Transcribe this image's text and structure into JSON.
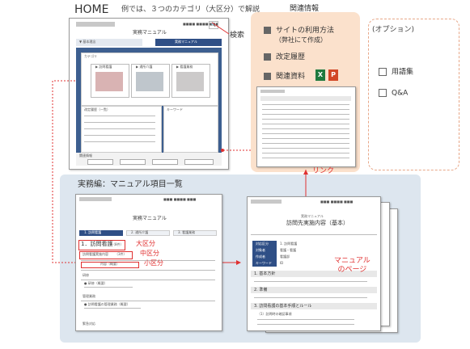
{
  "home": {
    "label": "HOME",
    "caption": "例では、３つのカテゴリ（大区分）で解説",
    "search_label": "検索"
  },
  "home_shot": {
    "site_title": "実務マニュアル",
    "tab_left": "▼ 基本理念",
    "tab_right": "実務マニュアル",
    "category_header": "カテゴリ",
    "cat1": "▶ 訪問看護",
    "cat2": "▶ 通所介護",
    "cat3": "▶ 看護業務",
    "update_header": "改定履歴（一覧）",
    "keyword_header": "キーワード",
    "links_header": "関連情報"
  },
  "related": {
    "title": "関連情報",
    "item1": "サイトの利用方法",
    "item1_sub": "（弊社にて作成）",
    "item2": "改定履歴",
    "item3": "関連資料",
    "excel_letter": "X",
    "ppt_letter": "P"
  },
  "option": {
    "title": "(オプション)",
    "item1": "用語集",
    "item2": "Q&A"
  },
  "link_label": "リンク",
  "list_section": {
    "title": "実務編：マニュアル項目一覧",
    "site_title": "実務マニュアル",
    "tab_active": "1. 訪問看護",
    "tab2": "2. 通所介護",
    "tab3": "3. 看護業務",
    "major": "1．訪問看護",
    "major_count": "（8件）",
    "mid": "訪問看護実施内容",
    "mid_count": "（3件）",
    "minor": "内容（概要）",
    "label_major": "大区分",
    "label_mid": "中区分",
    "label_minor": "小区分",
    "row1": "研修",
    "row2": "● 研修（概要）",
    "row3": "管理業務",
    "row4": "● 訪問看護の管理業務（概要）",
    "row5": "緊急対応"
  },
  "manual_page": {
    "site_small": "実務マニュアル",
    "title": "訪問先実施内容（基本）",
    "label": "マニュアル\nのページ",
    "field1": "1. 基本方針",
    "field2": "2. 準備",
    "field3": "3. 訪問看護の基本手順とルール",
    "field3_sub": "（1）訪問時の確認事項",
    "kv1k": "対応区分",
    "kv2k": "対象者",
    "kv3k": "作成者",
    "kv4k": "キーワード",
    "kv1v": "1. 訪問看護",
    "kv2v": "看護・看護",
    "kv3v": "看護部",
    "kv4v": "ID"
  },
  "colors": {
    "accent_red": "#e03030",
    "blue_panel": "#dde6ef",
    "peach_panel": "#fbe1cc",
    "navy": "#2f4f86"
  }
}
